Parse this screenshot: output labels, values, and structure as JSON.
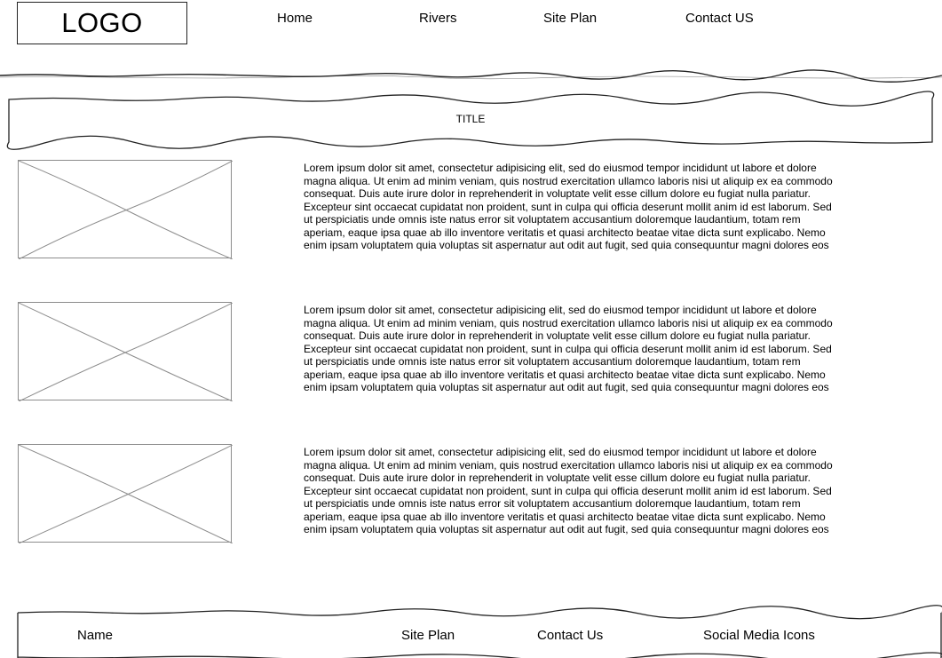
{
  "header": {
    "logo": "LOGO",
    "nav": [
      "Home",
      "Rivers",
      "Site Plan",
      "Contact US"
    ]
  },
  "title": "TITLE",
  "content": {
    "items": [
      {
        "image_alt": "image placeholder",
        "text": "Lorem ipsum dolor sit amet, consectetur adipisicing elit, sed do eiusmod tempor incididunt ut labore et dolore magna aliqua. Ut enim ad minim veniam, quis nostrud exercitation ullamco laboris nisi ut aliquip ex ea commodo consequat. Duis aute irure dolor in reprehenderit in voluptate velit esse cillum dolore eu fugiat nulla pariatur. Excepteur sint occaecat cupidatat non proident, sunt in culpa qui officia deserunt mollit anim id est laborum. Sed ut perspiciatis unde omnis iste natus error sit voluptatem accusantium doloremque laudantium, totam rem aperiam, eaque ipsa quae ab illo inventore veritatis et quasi architecto beatae vitae dicta sunt explicabo. Nemo enim ipsam voluptatem quia voluptas sit aspernatur aut odit aut fugit, sed quia consequuntur magni dolores eos"
      },
      {
        "image_alt": "image placeholder",
        "text": "Lorem ipsum dolor sit amet, consectetur adipisicing elit, sed do eiusmod tempor incididunt ut labore et dolore magna aliqua. Ut enim ad minim veniam, quis nostrud exercitation ullamco laboris nisi ut aliquip ex ea commodo consequat. Duis aute irure dolor in reprehenderit in voluptate velit esse cillum dolore eu fugiat nulla pariatur. Excepteur sint occaecat cupidatat non proident, sunt in culpa qui officia deserunt mollit anim id est laborum. Sed ut perspiciatis unde omnis iste natus error sit voluptatem accusantium doloremque laudantium, totam rem aperiam, eaque ipsa quae ab illo inventore veritatis et quasi architecto beatae vitae dicta sunt explicabo. Nemo enim ipsam voluptatem quia voluptas sit aspernatur aut odit aut fugit, sed quia consequuntur magni dolores eos"
      },
      {
        "image_alt": "image placeholder",
        "text": "Lorem ipsum dolor sit amet, consectetur adipisicing elit, sed do eiusmod tempor incididunt ut labore et dolore magna aliqua. Ut enim ad minim veniam, quis nostrud exercitation ullamco laboris nisi ut aliquip ex ea commodo consequat. Duis aute irure dolor in reprehenderit in voluptate velit esse cillum dolore eu fugiat nulla pariatur. Excepteur sint occaecat cupidatat non proident, sunt in culpa qui officia deserunt mollit anim id est laborum. Sed ut perspiciatis unde omnis iste natus error sit voluptatem accusantium doloremque laudantium, totam rem aperiam, eaque ipsa quae ab illo inventore veritatis et quasi architecto beatae vitae dicta sunt explicabo. Nemo enim ipsam voluptatem quia voluptas sit aspernatur aut odit aut fugit, sed quia consequuntur magni dolores eos"
      }
    ]
  },
  "footer": {
    "name": "Name",
    "site_plan": "Site Plan",
    "contact": "Contact Us",
    "social": "Social Media Icons"
  },
  "colors": {
    "stroke": "#222222",
    "placeholder": "#8c8c8c",
    "background": "#ffffff"
  }
}
